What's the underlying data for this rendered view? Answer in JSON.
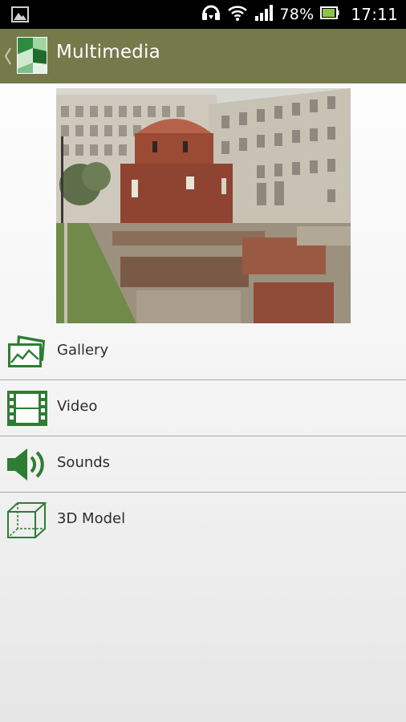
{
  "status_bar": {
    "battery": "78%",
    "time": "17:11",
    "icons": [
      "image-notification-icon",
      "headset-icon",
      "wifi-icon",
      "signal-icon",
      "battery-icon"
    ]
  },
  "action_bar": {
    "title": "Multimedia",
    "back_icon": "chevron-left-icon",
    "logo": "app-logo-icon",
    "color": "#767a4b"
  },
  "hero_image": {
    "subject": "photo"
  },
  "menu": {
    "accent_color": "#2e7d32",
    "items": [
      {
        "label": "Gallery",
        "icon": "gallery-icon"
      },
      {
        "label": "Video",
        "icon": "film-strip-icon"
      },
      {
        "label": "Sounds",
        "icon": "speaker-icon"
      },
      {
        "label": "3D Model",
        "icon": "cube-icon"
      }
    ]
  }
}
